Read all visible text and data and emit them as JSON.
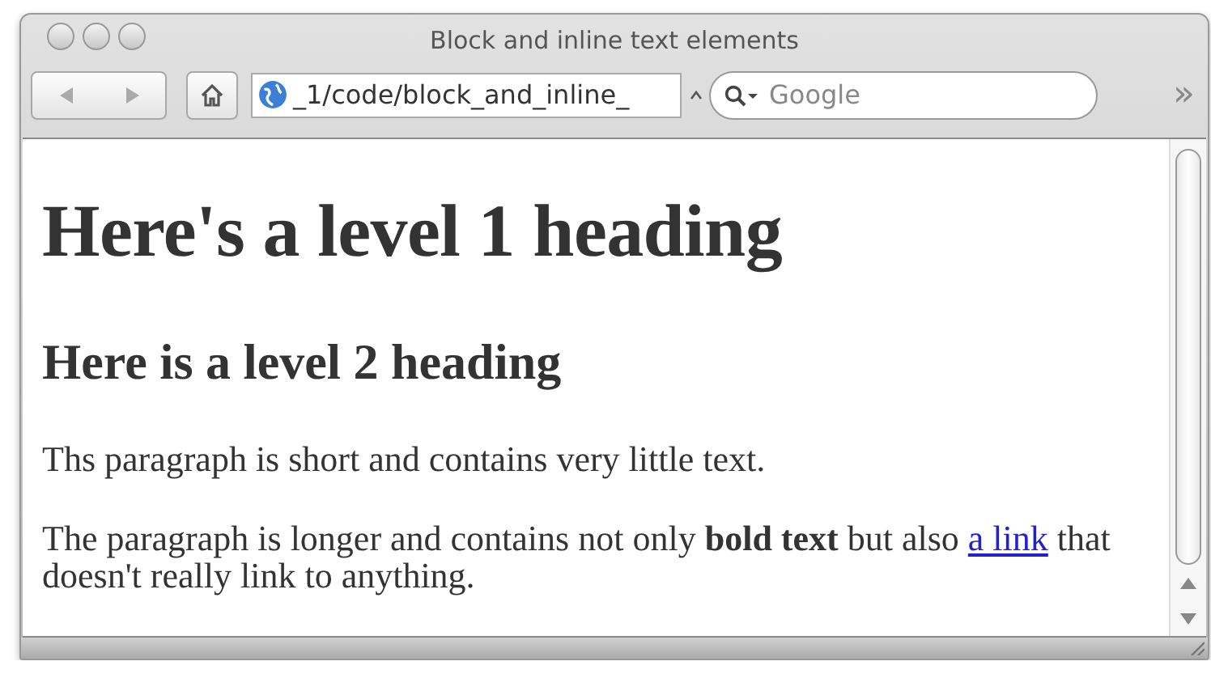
{
  "window": {
    "title": "Block and inline text elements"
  },
  "toolbar": {
    "address": "_1/code/block_and_inline_",
    "search_placeholder": "Google",
    "overflow": "»"
  },
  "page": {
    "heading_1": "Here's a level 1 heading",
    "heading_2": "Here is a level 2 heading",
    "paragraphs": [
      {
        "text": "Ths paragraph is short and contains very little text."
      },
      {
        "text": "The paragraph is longer and contains not only **bold text** but also",
        "link": "a link",
        "after": "that doesn't really link to anything."
      }
    ]
  }
}
